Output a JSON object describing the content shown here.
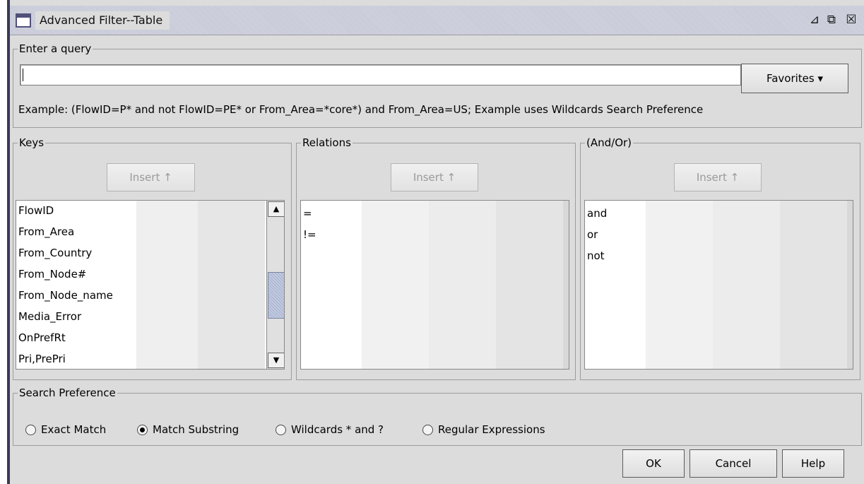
{
  "window": {
    "title": "Advanced Filter--Table",
    "restore_icon": "restore-window-icon",
    "maximize_icon": "maximize-window-icon",
    "close_icon": "close-window-icon",
    "restore_glyph": "⊿",
    "maximize_glyph": "⧉",
    "close_glyph": "☒"
  },
  "query": {
    "group_label": "Enter a query",
    "value": "",
    "favorites_label": "Favorites ▾",
    "example_text": "Example: (FlowID=P* and not FlowID=PE* or From_Area=*core*) and From_Area=US; Example uses Wildcards Search Preference"
  },
  "keys": {
    "group_label": "Keys",
    "insert_label": "Insert ↑",
    "items": [
      "FlowID",
      "From_Area",
      "From_Country",
      "From_Node#",
      "From_Node_name",
      "Media_Error",
      "OnPrefRt",
      "Pri,PrePri"
    ],
    "scroll_up": "▲",
    "scroll_down": "▼"
  },
  "relations": {
    "group_label": "Relations",
    "insert_label": "Insert ↑",
    "items": [
      "=",
      "!="
    ]
  },
  "andor": {
    "group_label": "(And/Or)",
    "insert_label": "Insert ↑",
    "items": [
      "and",
      "or",
      "not"
    ]
  },
  "search_preference": {
    "group_label": "Search Preference",
    "options": [
      {
        "label": "Exact Match",
        "selected": false
      },
      {
        "label": "Match Substring",
        "selected": true
      },
      {
        "label": "Wildcards * and ?",
        "selected": false
      },
      {
        "label": "Regular Expressions",
        "selected": false
      }
    ]
  },
  "buttons": {
    "ok": "OK",
    "cancel": "Cancel",
    "help": "Help"
  },
  "colors": {
    "panel": "#dcdcdc",
    "titlebar": "#c8cbd8",
    "border": "#9c9c9c"
  }
}
